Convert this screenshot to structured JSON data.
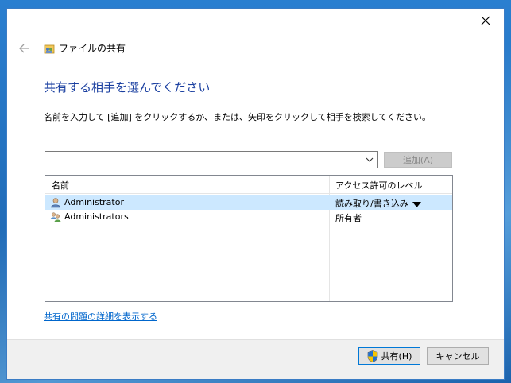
{
  "window": {
    "title": "ファイルの共有"
  },
  "heading": "共有する相手を選んでください",
  "instruction": "名前を入力して [追加] をクリックするか、または、矢印をクリックして相手を検索してください。",
  "combo": {
    "value": ""
  },
  "add_button": "追加(A)",
  "list": {
    "columns": [
      "名前",
      "アクセス許可のレベル"
    ],
    "rows": [
      {
        "name": "Administrator",
        "permission": "読み取り/書き込み",
        "selected": true
      },
      {
        "name": "Administrators",
        "permission": "所有者",
        "selected": false
      }
    ]
  },
  "detail_link": "共有の問題の詳細を表示する",
  "footer": {
    "share_label": "共有(H)",
    "cancel_label": "キャンセル"
  },
  "colors": {
    "heading": "#1a3fa0",
    "selection": "#cce8ff",
    "link": "#0066cc",
    "desktop": "#1e6fb8"
  }
}
